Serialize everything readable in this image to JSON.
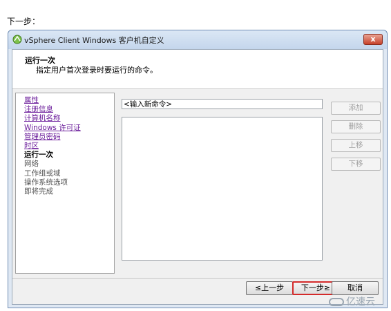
{
  "caption": "下一步：",
  "window": {
    "title": "vSphere Client Windows 客户机自定义",
    "close_glyph": "x"
  },
  "header": {
    "title": "运行一次",
    "subtitle": "指定用户首次登录时要运行的命令。"
  },
  "nav": [
    {
      "label": "属性",
      "state": "link"
    },
    {
      "label": "注册信息",
      "state": "link"
    },
    {
      "label": "计算机名称",
      "state": "link"
    },
    {
      "label": "Windows 许可证",
      "state": "link"
    },
    {
      "label": "管理员密码",
      "state": "link"
    },
    {
      "label": "时区",
      "state": "link"
    },
    {
      "label": "运行一次",
      "state": "current"
    },
    {
      "label": "网络",
      "state": "disabled"
    },
    {
      "label": "工作组或域",
      "state": "disabled"
    },
    {
      "label": "操作系统选项",
      "state": "disabled"
    },
    {
      "label": "即将完成",
      "state": "disabled"
    }
  ],
  "command": {
    "input_value": "<输入新命令>"
  },
  "buttons": {
    "add": "添加",
    "delete": "删除",
    "up": "上移",
    "down": "下移",
    "prev": "≤上一步",
    "next": "下一步≥",
    "cancel": "取消"
  },
  "watermark": "亿速云",
  "colors": {
    "link": "#6a1b9a",
    "highlight_border": "#d42a2a",
    "close_button": "#c7412a"
  }
}
